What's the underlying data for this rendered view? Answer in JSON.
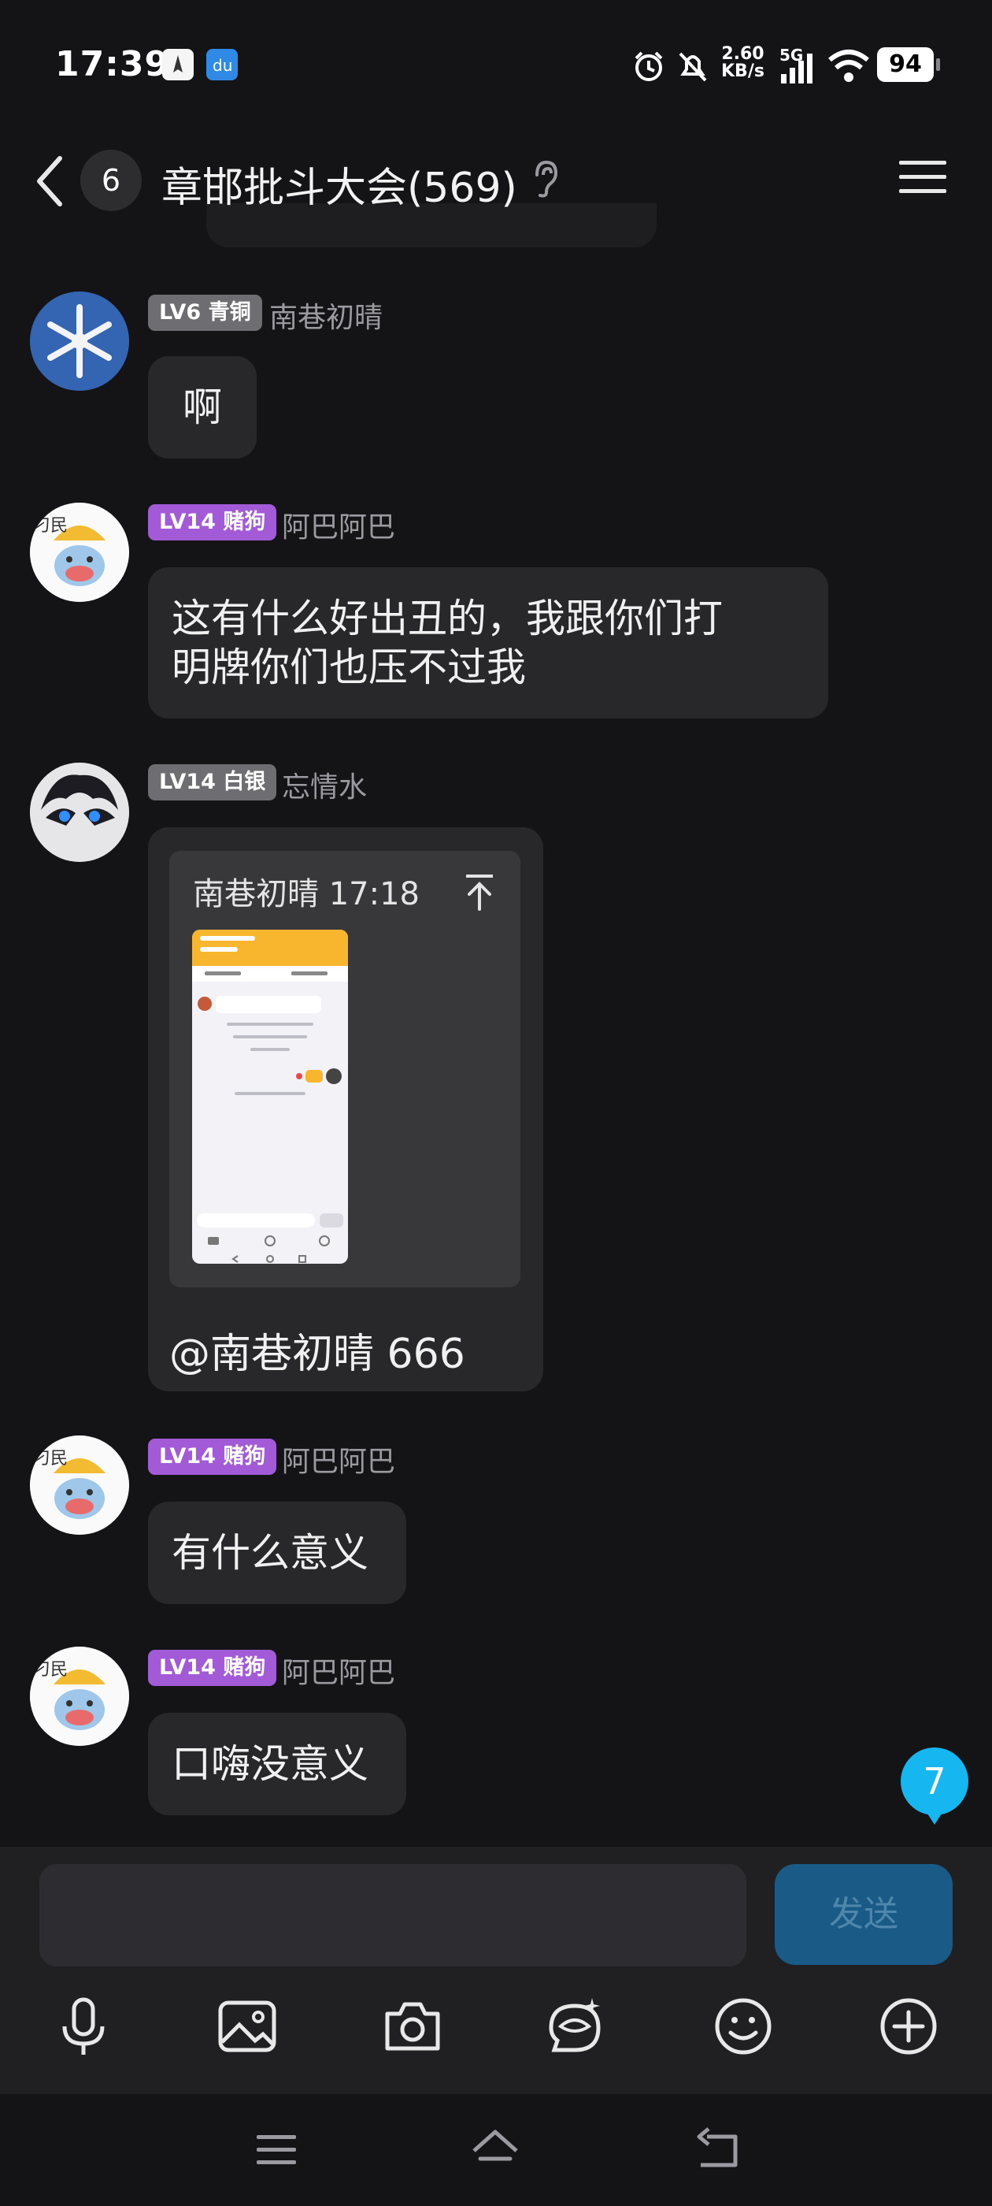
{
  "status_bar": {
    "time": "17:39",
    "net_speed_value": "2.60",
    "net_speed_unit": "KB/s",
    "network": "5G",
    "battery": "94"
  },
  "header": {
    "unread_count": "6",
    "title": "章邯批斗大会(569)"
  },
  "messages": [
    {
      "level": "LV6 青铜",
      "nickname": "南巷初晴",
      "text": "啊"
    },
    {
      "level": "LV14 赌狗",
      "nickname": "阿巴阿巴",
      "text_line1": "这有什么好出丑的，我跟你们打",
      "text_line2": "明牌你们也压不过我"
    },
    {
      "level": "LV14 白银",
      "nickname": "忘情水",
      "quote_meta": "南巷初晴 17:18",
      "text": "@南巷初晴 666"
    },
    {
      "level": "LV14 赌狗",
      "nickname": "阿巴阿巴",
      "text": "有什么意义"
    },
    {
      "level": "LV14 赌狗",
      "nickname": "阿巴阿巴",
      "text": "口嗨没意义"
    }
  ],
  "new_messages_count": "7",
  "input": {
    "value": "",
    "send_label": "发送"
  },
  "toolbar_icons": [
    "microphone-icon",
    "image-icon",
    "camera-icon",
    "magic-emoji-icon",
    "emoji-icon",
    "plus-icon"
  ],
  "nav_icons": [
    "menu-icon",
    "home-icon",
    "back-icon"
  ],
  "colors": {
    "background": "#141416",
    "bubble": "#28282b",
    "badge_gray": "#6d6d72",
    "badge_purple": "#a25ad6",
    "unread_blue": "#16b6f0",
    "send_button": "#1a5a87"
  }
}
